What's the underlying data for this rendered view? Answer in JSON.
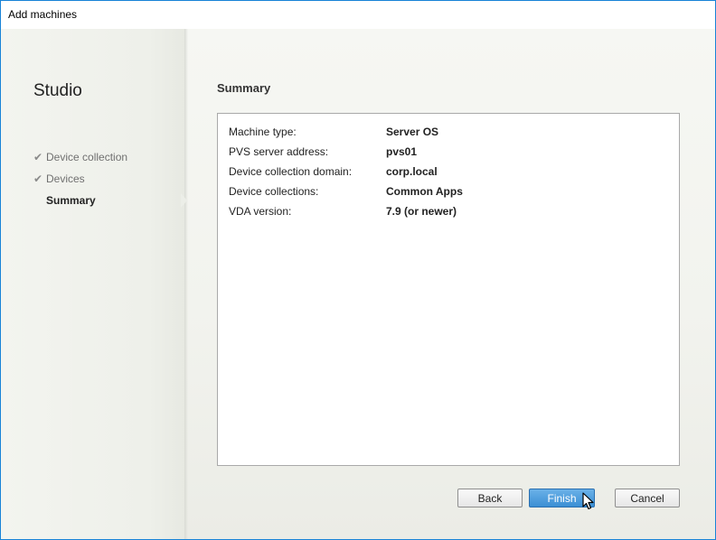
{
  "window": {
    "title": "Add machines"
  },
  "sidebar": {
    "app_title": "Studio",
    "steps": [
      {
        "label": "Device collection",
        "state": "completed",
        "icon": "check-icon"
      },
      {
        "label": "Devices",
        "state": "completed",
        "icon": "check-icon"
      },
      {
        "label": "Summary",
        "state": "current",
        "icon": ""
      }
    ]
  },
  "main": {
    "title": "Summary",
    "summary": [
      {
        "key": "Machine type:",
        "value": "Server OS"
      },
      {
        "key": "PVS server address:",
        "value": "pvs01"
      },
      {
        "key": "Device collection domain:",
        "value": "corp.local"
      },
      {
        "key": "Device collections:",
        "value": "Common Apps"
      },
      {
        "key": "VDA version:",
        "value": "7.9 (or newer)"
      }
    ]
  },
  "buttons": {
    "back": "Back",
    "finish": "Finish",
    "cancel": "Cancel"
  },
  "colors": {
    "window_border": "#1883d7",
    "primary_button": "#3b8fd4"
  },
  "check_glyph": "✔"
}
